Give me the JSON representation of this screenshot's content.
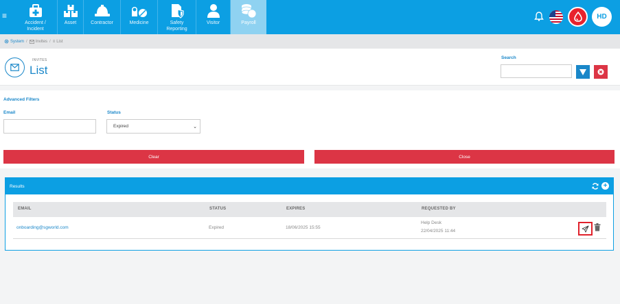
{
  "nav": {
    "items": [
      {
        "label": "Accident / Incident",
        "icon": "first-aid-kit-icon"
      },
      {
        "label": "Asset",
        "icon": "boxes-icon"
      },
      {
        "label": "Contractor",
        "icon": "hard-hat-icon"
      },
      {
        "label": "Medicine",
        "icon": "pills-icon"
      },
      {
        "label": "Safety Reporting",
        "icon": "safety-report-icon"
      },
      {
        "label": "Visitor",
        "icon": "person-icon"
      },
      {
        "label": "Payroll",
        "icon": "coins-icon"
      }
    ],
    "active": "Payroll",
    "avatar_initials": "HD"
  },
  "breadcrumb": {
    "items": [
      "System",
      "Invites",
      "List"
    ]
  },
  "header": {
    "kicker": "INVITES",
    "title": "List",
    "search_label": "Search",
    "search_value": ""
  },
  "filters": {
    "title": "Advanced Filters",
    "email_label": "Email",
    "email_value": "",
    "status_label": "Status",
    "status_value": "Expired",
    "clear_label": "Clear",
    "close_label": "Close"
  },
  "results": {
    "title": "Results",
    "columns": [
      "EMAIL",
      "STATUS",
      "EXPIRES",
      "REQUESTED BY"
    ],
    "rows": [
      {
        "email": "onboarding@sgworld.com",
        "status": "Expired",
        "expires": "18/06/2025 15:55",
        "requested_by": "Help Desk",
        "requested_at": "22/04/2025 11:44"
      }
    ]
  },
  "colors": {
    "primary": "#0c9fe3",
    "link": "#1a87c9",
    "danger": "#dc3545"
  }
}
